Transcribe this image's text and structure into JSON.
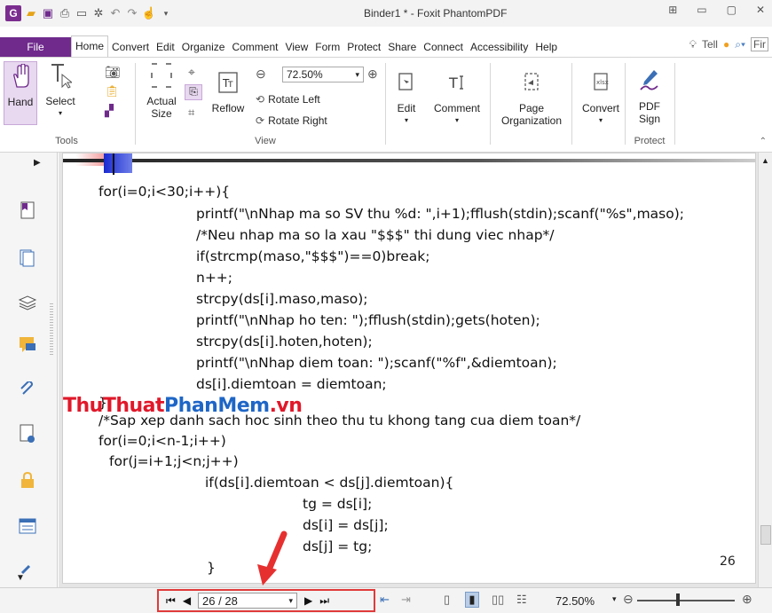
{
  "window": {
    "title": "Binder1 * - Foxit PhantomPDF"
  },
  "menu": {
    "file": "File",
    "tabs": [
      "Home",
      "Convert",
      "Edit",
      "Organize",
      "Comment",
      "View",
      "Form",
      "Protect",
      "Share",
      "Connect",
      "Accessibility",
      "Help"
    ],
    "tell": "Tell",
    "find": "Fir"
  },
  "ribbon": {
    "hand": "Hand",
    "select": "Select",
    "tools_label": "Tools",
    "actual_size_1": "Actual",
    "actual_size_2": "Size",
    "reflow": "Reflow",
    "zoom": "72.50%",
    "rotate_left": "Rotate Left",
    "rotate_right": "Rotate Right",
    "view_label": "View",
    "edit": "Edit",
    "comment": "Comment",
    "page_org_1": "Page",
    "page_org_2": "Organization",
    "convert": "Convert",
    "pdf_sign_1": "PDF",
    "pdf_sign_2": "Sign",
    "protect_label": "Protect"
  },
  "document": {
    "lines": [
      "for(i=0;i<30;i++){",
      "printf(\"\\nNhap ma so SV thu %d: \",i+1);fflush(stdin);scanf(\"%s\",maso);",
      "/*Neu nhap ma so la xau \"$$$\" thi dung viec nhap*/",
      "if(strcmp(maso,\"$$$\")==0)break;",
      "n++;",
      "strcpy(ds[i].maso,maso);",
      "printf(\"\\nNhap ho ten: \");fflush(stdin);gets(hoten);",
      "strcpy(ds[i].hoten,hoten);",
      "printf(\"\\nNhap diem toan: \");scanf(\"%f\",&diemtoan);",
      "ds[i].diemtoan = diemtoan;",
      "}",
      "/*Sap xep danh sach hoc sinh theo thu tu khong tang cua diem toan*/",
      "for(i=0;i<n-1;i++)",
      "for(j=i+1;j<n;j++)",
      "if(ds[i].diemtoan < ds[j].diemtoan){",
      "tg = ds[i];",
      "ds[i] = ds[j];",
      "ds[j] = tg;",
      "}"
    ],
    "page_number": "26",
    "watermark_red": "ThuThuat",
    "watermark_blue": "PhanMem",
    "watermark_red2": ".vn"
  },
  "status": {
    "page_value": "26 / 28",
    "zoom": "72.50%"
  }
}
